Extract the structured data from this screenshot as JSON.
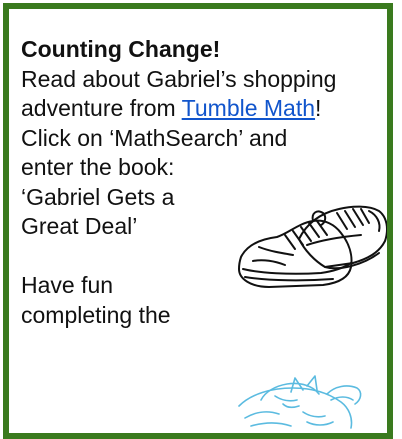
{
  "card": {
    "title": "Counting Change!",
    "line1": "Read about Gabriel’s shopping",
    "line2_pre": "adventure from ",
    "link_text": "Tumble Math",
    "line2_post": "!",
    "line3": "Click on ‘MathSearch’ and",
    "line4": "enter the book:",
    "line5": "‘Gabriel Gets a",
    "line6": "Great Deal’",
    "line7": "Have fun",
    "line8": "completing the"
  },
  "colors": {
    "border": "#3a7a1e",
    "link": "#1155cc",
    "sketch": "#5bbbe0"
  },
  "icons": {
    "shoes": "sneakers-illustration",
    "sketch": "blue-sketch-illustration"
  }
}
